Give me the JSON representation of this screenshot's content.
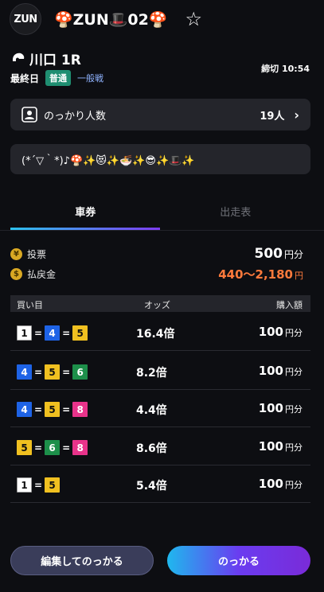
{
  "header": {
    "avatar_text": "ZUN",
    "username": "🍄ZUN🎩02🍄",
    "favorite_icon": "star-outline-icon"
  },
  "race": {
    "title": "川口 1R",
    "deadline": "締切 10:54",
    "day": "最終日",
    "badge": "普通",
    "class": "一般戦"
  },
  "followers": {
    "label": "のっかり人数",
    "count": "19人",
    "chevron": "›"
  },
  "comment": "(*´▽｀*)♪🍄✨😻✨🍜✨😎✨🎩✨",
  "tabs": {
    "active": "車券",
    "inactive": "出走表"
  },
  "summary": {
    "vote_label": "投票",
    "vote_amount": "500",
    "vote_unit": "円分",
    "payout_label": "払戻金",
    "payout_amount": "440～2,180",
    "payout_unit": "円"
  },
  "table": {
    "headers": {
      "bet": "買い目",
      "odds": "オッズ",
      "amount": "購入額"
    },
    "rows": [
      {
        "combo": [
          "1",
          "4",
          "5"
        ],
        "odds": "16.4倍",
        "amount": "100",
        "unit": "円分"
      },
      {
        "combo": [
          "4",
          "5",
          "6"
        ],
        "odds": "8.2倍",
        "amount": "100",
        "unit": "円分"
      },
      {
        "combo": [
          "4",
          "5",
          "8"
        ],
        "odds": "4.4倍",
        "amount": "100",
        "unit": "円分"
      },
      {
        "combo": [
          "5",
          "6",
          "8"
        ],
        "odds": "8.6倍",
        "amount": "100",
        "unit": "円分"
      },
      {
        "combo": [
          "1",
          "5"
        ],
        "odds": "5.4倍",
        "amount": "100",
        "unit": "円分"
      }
    ]
  },
  "colors": {
    "accent_gradient_start": "#2cc2ee",
    "accent_gradient_end": "#7d3cf0",
    "payout": "#ff7a3c",
    "badge": "#1f8e71"
  },
  "buttons": {
    "edit": "編集してのっかる",
    "ride": "のっかる"
  }
}
